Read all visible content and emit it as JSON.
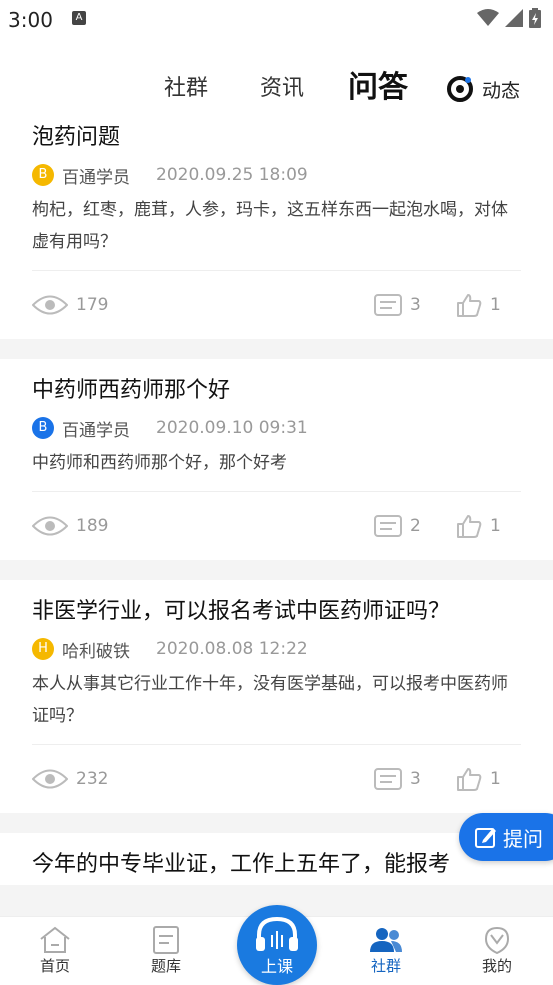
{
  "status": {
    "time": "3:00",
    "notif_icon": "A"
  },
  "header": {
    "tabs": [
      {
        "label": "社群"
      },
      {
        "label": "资讯"
      },
      {
        "label": "问答"
      }
    ],
    "dynamic_label": "动态"
  },
  "posts": [
    {
      "title": "泡药问题",
      "avatar_letter": "B",
      "avatar_color": "#f5b800",
      "author": "百通学员",
      "date": "2020.09.25 18:09",
      "body": "枸杞，红枣，鹿茸，人参，玛卡，这五样东西一起泡水喝，对体虚有用吗？",
      "views": "179",
      "comments": "3",
      "likes": "1"
    },
    {
      "title": "中药师西药师那个好",
      "avatar_letter": "B",
      "avatar_color": "#1a73e8",
      "author": "百通学员",
      "date": "2020.09.10 09:31",
      "body": "中药师和西药师那个好，那个好考",
      "views": "189",
      "comments": "2",
      "likes": "1"
    },
    {
      "title": "非医学行业，可以报名考试中医药师证吗？",
      "avatar_letter": "H",
      "avatar_color": "#f5b800",
      "author": "哈利破铁",
      "date": "2020.08.08 12:22",
      "body": "本人从事其它行业工作十年，没有医学基础，可以报考中医药师证吗？",
      "views": "232",
      "comments": "3",
      "likes": "1"
    },
    {
      "title": "今年的中专毕业证，工作上五年了，能报考"
    }
  ],
  "ask_button": "提问",
  "tabbar": {
    "home": "首页",
    "bank": "题库",
    "class": "上课",
    "community": "社群",
    "mine": "我的"
  },
  "colors": {
    "accent": "#1a73e8",
    "active_tab": "#1565c0"
  }
}
